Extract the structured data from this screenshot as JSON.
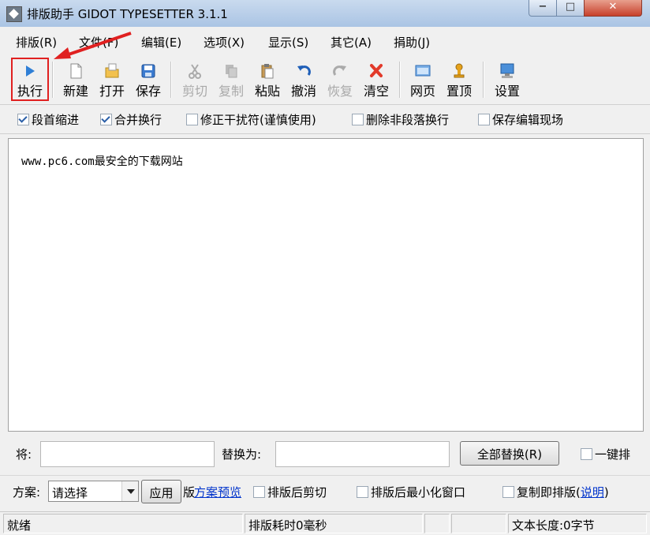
{
  "window": {
    "title": "排版助手 GIDOT TYPESETTER 3.1.1",
    "buttons": {
      "minimize": "−",
      "maximize": "□",
      "close": "✕"
    }
  },
  "menu": [
    {
      "label": "排版(R)"
    },
    {
      "label": "文件(F)"
    },
    {
      "label": "编辑(E)"
    },
    {
      "label": "选项(X)"
    },
    {
      "label": "显示(S)"
    },
    {
      "label": "其它(A)"
    },
    {
      "label": "捐助(J)"
    }
  ],
  "toolbar": [
    {
      "label": "执行",
      "icon": "play-icon",
      "enabled": true
    },
    {
      "label": "新建",
      "icon": "new-document-icon",
      "enabled": true
    },
    {
      "label": "打开",
      "icon": "open-folder-icon",
      "enabled": true
    },
    {
      "label": "保存",
      "icon": "save-disk-icon",
      "enabled": true
    },
    {
      "label": "剪切",
      "icon": "scissors-icon",
      "enabled": false
    },
    {
      "label": "复制",
      "icon": "copy-icon",
      "enabled": false
    },
    {
      "label": "粘贴",
      "icon": "paste-icon",
      "enabled": true
    },
    {
      "label": "撤消",
      "icon": "undo-icon",
      "enabled": true
    },
    {
      "label": "恢复",
      "icon": "redo-icon",
      "enabled": false
    },
    {
      "label": "清空",
      "icon": "clear-x-icon",
      "enabled": true
    },
    {
      "label": "网页",
      "icon": "webpage-icon",
      "enabled": true
    },
    {
      "label": "置顶",
      "icon": "pin-top-icon",
      "enabled": true
    },
    {
      "label": "设置",
      "icon": "settings-monitor-icon",
      "enabled": true
    }
  ],
  "options": [
    {
      "label": "段首缩进",
      "checked": true
    },
    {
      "label": "合并换行",
      "checked": true
    },
    {
      "label": "修正干扰符(谨慎使用)",
      "checked": false
    },
    {
      "label": "删除非段落换行",
      "checked": false
    },
    {
      "label": "保存编辑现场",
      "checked": false
    }
  ],
  "editor": {
    "content": "www.pc6.com最安全的下载网站"
  },
  "replace": {
    "find_label": "将:",
    "find_value": "",
    "replace_label": "替换为:",
    "replace_value": "",
    "replace_all_button": "全部替换(R)",
    "one_click_label": "一键排"
  },
  "scheme": {
    "label": "方案:",
    "selected": "请选择",
    "apply_button": "应用",
    "preview_link": "方案预览",
    "preview_prefix": "版",
    "cut_after": "排版后剪切",
    "minimize_after": "排版后最小化窗口",
    "copy_typeset": "复制即排版(",
    "help_link": "说明",
    "help_suffix": ")"
  },
  "status": {
    "ready": "就绪",
    "elapsed": "排版耗时0毫秒",
    "length": "文本长度:0字节"
  },
  "colors": {
    "annotation_red": "#e02020",
    "link_blue": "#0033cc",
    "close_red": "#c7402b"
  }
}
